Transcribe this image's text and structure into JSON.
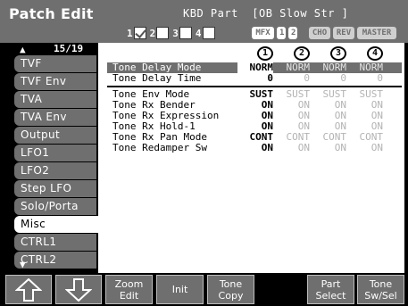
{
  "header": {
    "title": "Patch Edit",
    "part_label": "KBD Part  [OB Slow Str ]",
    "tone_switches": [
      {
        "num": "1",
        "checked": true
      },
      {
        "num": "2",
        "checked": false
      },
      {
        "num": "3",
        "checked": false
      },
      {
        "num": "4",
        "checked": false
      }
    ],
    "effects": [
      "MFX",
      "1",
      "2",
      "CHO",
      "REV",
      "MASTER"
    ]
  },
  "sidebar": {
    "page_indicator": "15/19",
    "items": [
      "TVF",
      "TVF Env",
      "TVA",
      "TVA Env",
      "Output",
      "LFO1",
      "LFO2",
      "Step LFO",
      "Solo/Porta",
      "Misc",
      "CTRL1",
      "CTRL2"
    ],
    "active_item": "Misc"
  },
  "table": {
    "tone_headers": [
      "1",
      "2",
      "3",
      "4"
    ],
    "group1": [
      {
        "label": "Tone Delay Mode",
        "values": [
          "NORM",
          "NORM",
          "NORM",
          "NORM"
        ],
        "selected": true
      },
      {
        "label": "Tone Delay Time",
        "values": [
          "0",
          "0",
          "0",
          "0"
        ]
      }
    ],
    "group2": [
      {
        "label": "Tone Env Mode",
        "values": [
          "SUST",
          "SUST",
          "SUST",
          "SUST"
        ]
      },
      {
        "label": "Tone Rx Bender",
        "values": [
          "ON",
          "ON",
          "ON",
          "ON"
        ]
      },
      {
        "label": "Tone Rx Expression",
        "values": [
          "ON",
          "ON",
          "ON",
          "ON"
        ]
      },
      {
        "label": "Tone Rx Hold-1",
        "values": [
          "ON",
          "ON",
          "ON",
          "ON"
        ]
      },
      {
        "label": "Tone Rx Pan Mode",
        "values": [
          "CONT",
          "CONT",
          "CONT",
          "CONT"
        ]
      },
      {
        "label": "Tone Redamper Sw",
        "values": [
          "ON",
          "ON",
          "ON",
          "ON"
        ]
      }
    ]
  },
  "buttons": {
    "zoom_edit": [
      "Zoom",
      "Edit"
    ],
    "init": "Init",
    "tone_copy": [
      "Tone",
      "Copy"
    ],
    "part_select": [
      "Part",
      "Select"
    ],
    "tone_sw_sel": [
      "Tone",
      "Sw/Sel"
    ]
  },
  "icons": {
    "up_arrow": "up-arrow-icon",
    "down_arrow": "down-arrow-icon"
  },
  "colors": {
    "panel_gray": "#6f6f6f",
    "dim_value": "#b3b3b3",
    "background": "#000000",
    "panel_white": "#ffffff"
  }
}
